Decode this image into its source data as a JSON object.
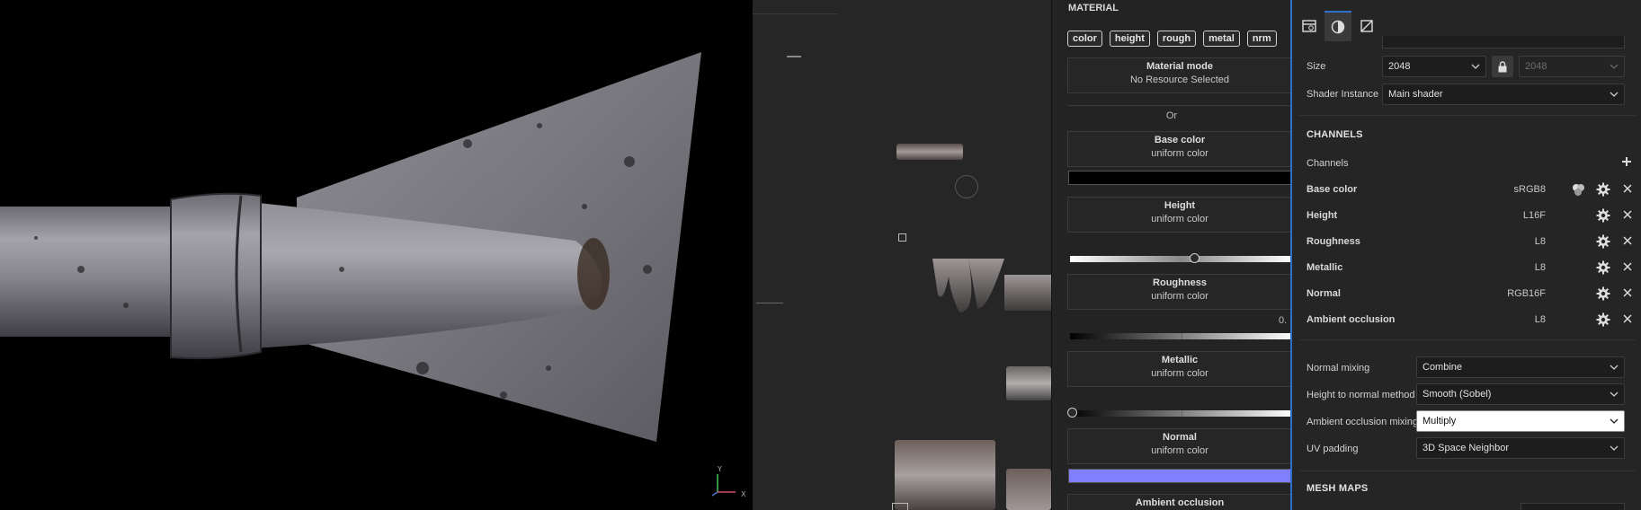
{
  "material_panel": {
    "title": "MATERIAL",
    "tabs": [
      "color",
      "height",
      "rough",
      "metal",
      "nrm"
    ],
    "material_mode": {
      "title": "Material mode",
      "subtitle": "No Resource Selected"
    },
    "or_label": "Or",
    "blocks": [
      {
        "title": "Base color",
        "subtitle": "uniform color"
      },
      {
        "title": "Height",
        "subtitle": "uniform color"
      },
      {
        "title": "Roughness",
        "subtitle": "uniform color"
      },
      {
        "title": "Metallic",
        "subtitle": "uniform color"
      },
      {
        "title": "Normal",
        "subtitle": "uniform color"
      },
      {
        "title": "Ambient occlusion",
        "subtitle": ""
      }
    ],
    "roughness_value": "0.",
    "base_color_swatch": "#000000",
    "normal_color_swatch": "#7f7fff",
    "height_slider_value": 0.5,
    "metallic_slider_value": 0.0
  },
  "settings_panel": {
    "toolbar_icons": [
      "texture-set-settings-icon",
      "display-settings-icon",
      "uv-crop-icon"
    ],
    "size_label": "Size",
    "size_value": "2048",
    "size_value_locked": "2048",
    "shader_label": "Shader Instance",
    "shader_value": "Main shader",
    "channels_section": "CHANNELS",
    "channels_label": "Channels",
    "channels": [
      {
        "name": "Base color",
        "format": "sRGB8",
        "has_mix": true
      },
      {
        "name": "Height",
        "format": "L16F",
        "has_mix": false
      },
      {
        "name": "Roughness",
        "format": "L8",
        "has_mix": false
      },
      {
        "name": "Metallic",
        "format": "L8",
        "has_mix": false
      },
      {
        "name": "Normal",
        "format": "RGB16F",
        "has_mix": false
      },
      {
        "name": "Ambient occlusion",
        "format": "L8",
        "has_mix": false
      }
    ],
    "normal_mixing_label": "Normal mixing",
    "normal_mixing_value": "Combine",
    "height_to_normal_label": "Height to normal method",
    "height_to_normal_value": "Smooth (Sobel)",
    "ao_mixing_label": "Ambient occlusion mixing",
    "ao_mixing_value": "Multiply",
    "uv_padding_label": "UV padding",
    "uv_padding_value": "3D Space Neighbor",
    "mesh_maps_section": "MESH MAPS"
  },
  "viewport": {
    "axis_y": "Y",
    "axis_x": "X"
  },
  "colors": {
    "accent": "#2f6fcb",
    "metal_light": "#9a98a0",
    "metal_dark": "#3d3c42"
  }
}
